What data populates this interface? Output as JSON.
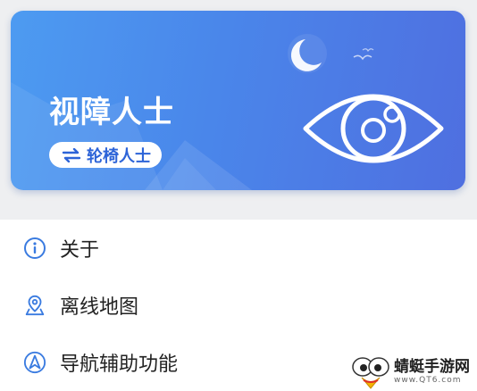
{
  "banner": {
    "title": "视障人士",
    "switch_label": "轮椅人士"
  },
  "menu": {
    "items": [
      {
        "label": "关于",
        "icon": "info-icon"
      },
      {
        "label": "离线地图",
        "icon": "map-pin-icon"
      },
      {
        "label": "导航辅助功能",
        "icon": "navigation-icon"
      }
    ]
  },
  "watermark": {
    "title": "蜻蜓手游网",
    "url": "www.QT6.com"
  },
  "colors": {
    "banner_start": "#4d9bf1",
    "banner_end": "#4f6fe0",
    "accent": "#2d64d8",
    "icon_blue": "#3a7be0"
  }
}
